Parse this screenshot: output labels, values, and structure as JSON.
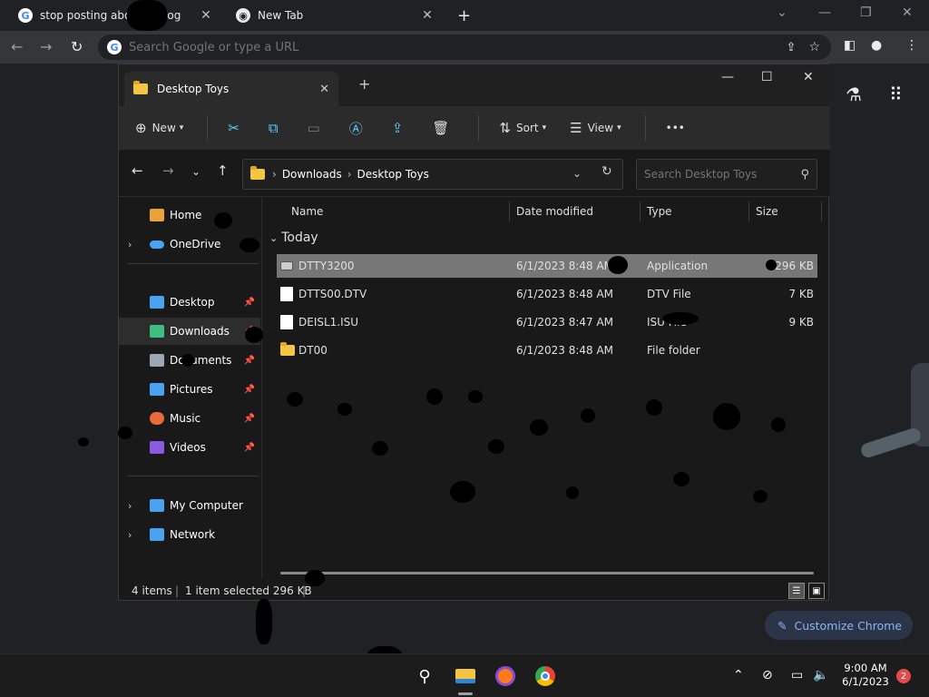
{
  "browser": {
    "tabs": [
      {
        "title": "stop posting abou… Goog",
        "icon": "google-icon"
      },
      {
        "title": "New Tab",
        "icon": "chrome-icon"
      }
    ],
    "new_tab_symbol": "+",
    "omnibox_placeholder": "Search Google or type a URL",
    "customize_label": "Customize Chrome"
  },
  "explorer": {
    "tab_title": "Desktop Toys",
    "commands": {
      "new": "New",
      "sort": "Sort",
      "view": "View",
      "more": "•••"
    },
    "breadcrumb": [
      "Downloads",
      "Desktop Toys"
    ],
    "search_placeholder": "Search Desktop Toys",
    "sidebar": [
      {
        "label": "Home",
        "icon": "home-icon",
        "color": "#e8a33b"
      },
      {
        "label": "OneDrive",
        "icon": "onedrive-icon",
        "color": "#4aa3f0"
      },
      {
        "label": "Desktop",
        "icon": "desktop-icon",
        "color": "#4aa3f0"
      },
      {
        "label": "Downloads",
        "icon": "download-icon",
        "color": "#3fbf7f"
      },
      {
        "label": "Documents",
        "icon": "documents-icon",
        "color": "#9aa7b5"
      },
      {
        "label": "Pictures",
        "icon": "pictures-icon",
        "color": "#4aa3f0"
      },
      {
        "label": "Music",
        "icon": "music-icon",
        "color": "#e8693b"
      },
      {
        "label": "Videos",
        "icon": "videos-icon",
        "color": "#8a5be0"
      },
      {
        "label": "My Computer",
        "icon": "computer-icon",
        "color": "#4aa3f0"
      },
      {
        "label": "Network",
        "icon": "network-icon",
        "color": "#4aa3f0"
      }
    ],
    "columns": {
      "name": "Name",
      "date": "Date modified",
      "type": "Type",
      "size": "Size"
    },
    "group": "Today",
    "files": [
      {
        "name": "DTTY3200",
        "date": "6/1/2023 8:48 AM",
        "type": "Application",
        "size": "296 KB",
        "icon": "application-icon"
      },
      {
        "name": "DTTS00.DTV",
        "date": "6/1/2023 8:48 AM",
        "type": "DTV File",
        "size": "7 KB",
        "icon": "file-icon"
      },
      {
        "name": "DEISL1.ISU",
        "date": "6/1/2023 8:47 AM",
        "type": "ISU File",
        "size": "9 KB",
        "icon": "file-icon"
      },
      {
        "name": "DT00",
        "date": "6/1/2023 8:48 AM",
        "type": "File folder",
        "size": "",
        "icon": "folder-icon"
      }
    ],
    "status": {
      "count": "4 items",
      "selected": "1 item selected  296 KB"
    }
  },
  "taskbar": {
    "time": "9:00 AM",
    "date": "6/1/2023",
    "notifications": "2"
  }
}
